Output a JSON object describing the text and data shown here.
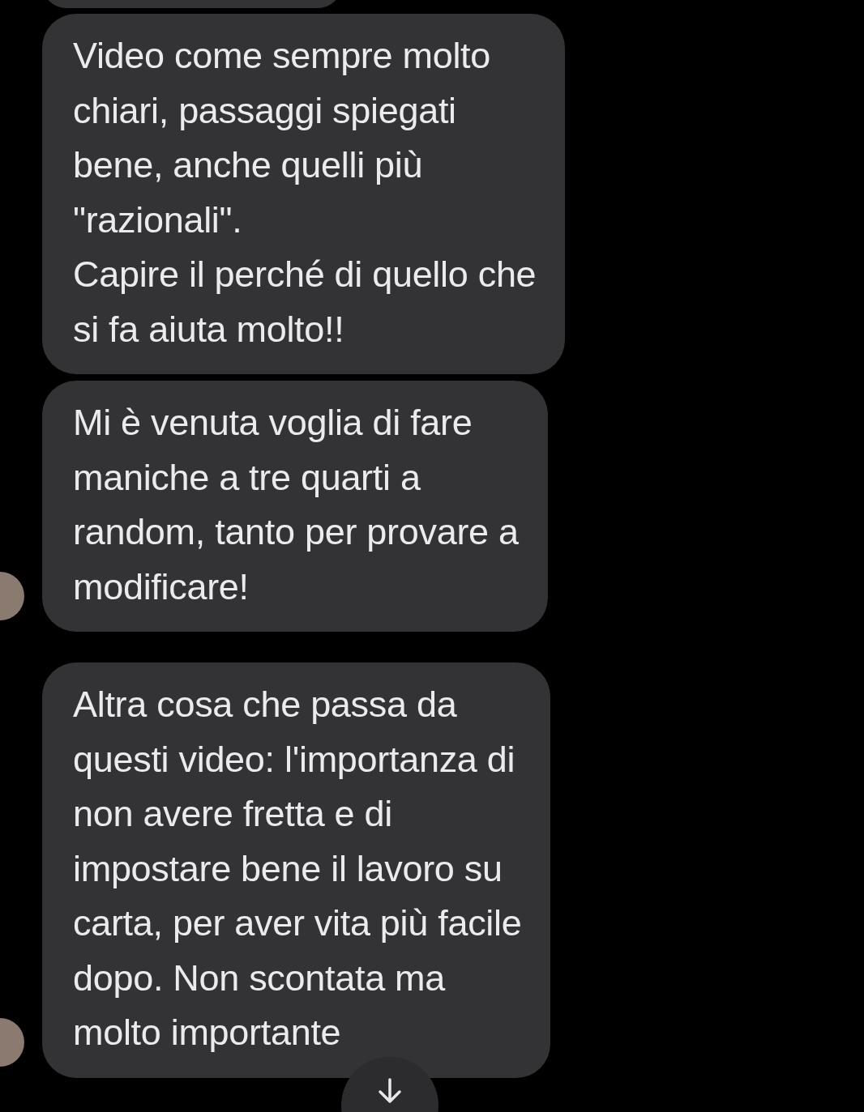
{
  "messages": [
    {
      "text": "Video come sempre molto\nchiari, passaggi spiegati\nbene, anche quelli più\n\"razionali\".\nCapire il perché di quello che\nsi fa aiuta molto!!",
      "avatar": false
    },
    {
      "text": "Mi è venuta voglia di fare\nmaniche a tre quarti a\nrandom, tanto per provare a\nmodificare!",
      "avatar": true
    },
    {
      "text": "Altra cosa che passa da\nquesti video: l'importanza di\nnon avere fretta e di\nimpostare bene il lavoro su\ncarta, per aver vita più facile\ndopo. Non scontata ma\nmolto importante",
      "avatar": true
    }
  ]
}
